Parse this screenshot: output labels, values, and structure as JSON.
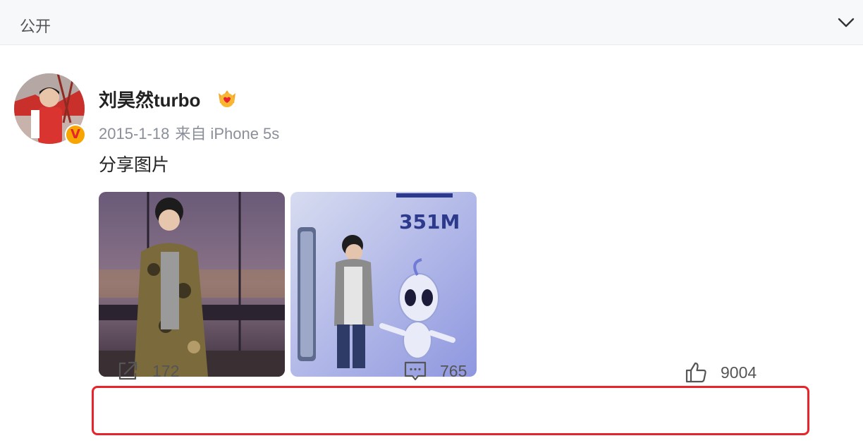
{
  "header": {
    "visibility": "公开",
    "collapse_icon": "chevron-down-icon"
  },
  "post": {
    "author": {
      "name": "刘昊然turbo",
      "verified_badge": "V",
      "badge_color": "#f7a500",
      "member_icon": "vip-heart-crown-icon"
    },
    "date": "2015-1-18",
    "source": "来自 iPhone 5s",
    "text": "分享图片",
    "photos": [
      {
        "icon": "photo-observation-deck"
      },
      {
        "icon": "photo-exhibit-wall",
        "caption": "351M"
      }
    ],
    "actions": {
      "repost": {
        "icon": "repost-icon",
        "count": "172"
      },
      "comment": {
        "icon": "comment-icon",
        "count": "765"
      },
      "like": {
        "icon": "thumbs-up-icon",
        "count": "9004"
      }
    },
    "highlight_color": "#e8232b"
  }
}
